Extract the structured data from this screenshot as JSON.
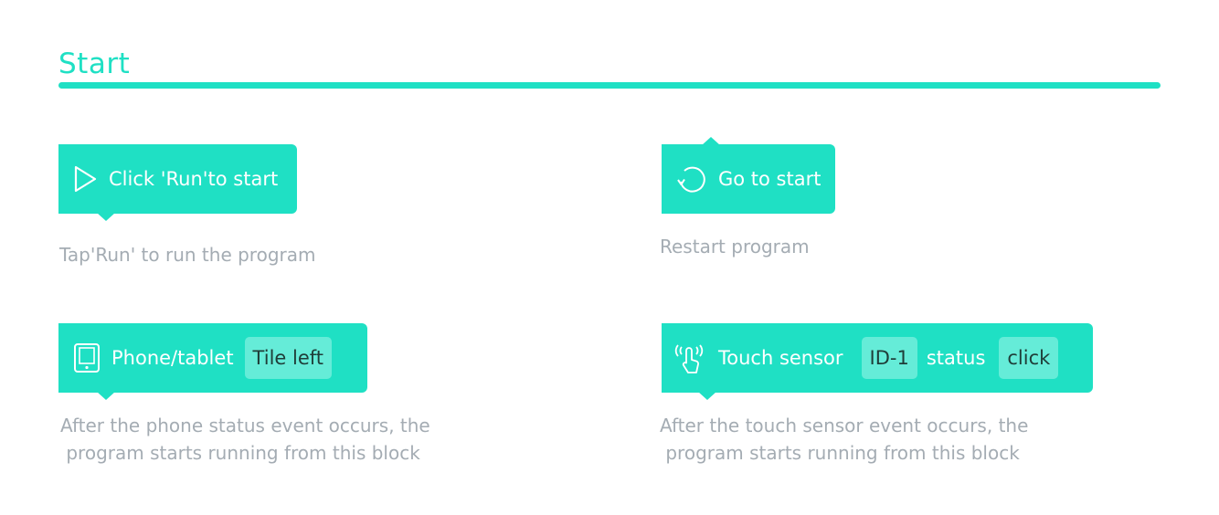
{
  "section": {
    "title": "Start"
  },
  "blocks": {
    "run": {
      "label": "Click 'Run'to start",
      "icon": "play-icon",
      "description": "Tap'Run' to run the program"
    },
    "goto": {
      "label": "Go to start",
      "icon": "restart-icon",
      "description": "Restart program"
    },
    "phone": {
      "label": "Phone/tablet",
      "icon": "tablet-icon",
      "option": "Tile left",
      "description": "After the phone status event occurs, the\n program starts running from this block"
    },
    "touch": {
      "label": "Touch sensor",
      "icon": "touch-icon",
      "id_option": "ID-1",
      "status_label": "status",
      "status_option": "click",
      "description": "After the touch sensor event occurs, the\n program starts running from this block"
    }
  },
  "colors": {
    "accent": "#1fe0c4",
    "chip": "#65ecd8",
    "description": "#a4acb3"
  }
}
